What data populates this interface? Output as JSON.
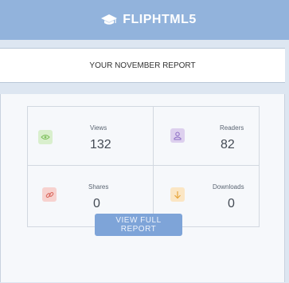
{
  "header": {
    "brand": "FLIPHTML5",
    "brand_icon": "graduation-cap-icon",
    "bg_color": "#92b3dc"
  },
  "report": {
    "title": "YOUR NOVEMBER REPORT"
  },
  "stats": {
    "views": {
      "label": "Views",
      "value": "132",
      "icon": "eye-icon",
      "icon_bg": "#d9efcd"
    },
    "readers": {
      "label": "Readers",
      "value": "82",
      "icon": "person-icon",
      "icon_bg": "#ddd0ee"
    },
    "shares": {
      "label": "Shares",
      "value": "0",
      "icon": "link-icon",
      "icon_bg": "#f7d2cf"
    },
    "downloads": {
      "label": "Downloads",
      "value": "0",
      "icon": "arrow-down-icon",
      "icon_bg": "#fbe6c4"
    }
  },
  "cta": {
    "label": "VIEW FULL REPORT",
    "color": "#7ea4d8"
  }
}
